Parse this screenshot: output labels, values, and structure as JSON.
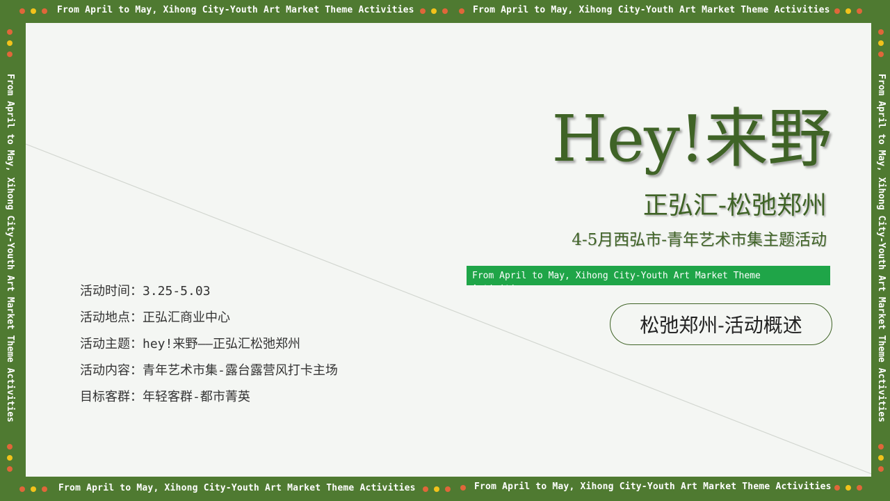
{
  "border": {
    "band_text": "From April to May, Xihong City-Youth Art Market Theme Activities"
  },
  "hero": {
    "title": "Hey!来野",
    "subtitle": "正弘汇-松弛郑州",
    "tagline": "4-5月西弘市-青年艺术市集主题活动",
    "english_bar": "From April to May, Xihong City-Youth Art Market Theme Activities"
  },
  "pill_button": {
    "label": "松弛郑州-活动概述"
  },
  "details": [
    {
      "label": "活动时间：",
      "value": "3.25-5.03"
    },
    {
      "label": "活动地点：",
      "value": "正弘汇商业中心"
    },
    {
      "label": "活动主题：",
      "value": "hey!来野——正弘汇松弛郑州"
    },
    {
      "label": "活动内容：",
      "value": "青年艺术市集-露台露营风打卡主场"
    },
    {
      "label": "目标客群：",
      "value": "年轻客群-都市菁英"
    }
  ],
  "colors": {
    "frame_green": "#4f7a31",
    "title_green": "#3f6326",
    "bar_green": "#1fa548",
    "dot_orange": "#e0663a",
    "dot_yellow": "#f2c21b"
  }
}
